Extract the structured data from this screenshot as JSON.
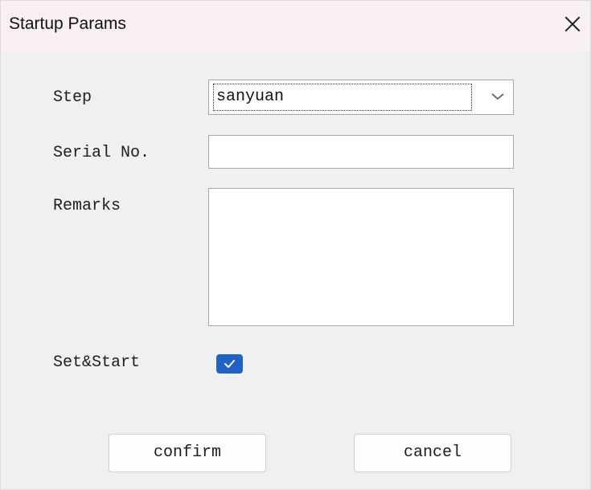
{
  "window": {
    "title": "Startup Params",
    "close_icon": "close-icon"
  },
  "form": {
    "step_label": "Step",
    "step_value": "sanyuan",
    "step_arrow_icon": "chevron-down-icon",
    "serial_label": "Serial No.",
    "serial_value": "",
    "remarks_label": "Remarks",
    "remarks_value": "",
    "set_start_label": "Set&Start",
    "set_start_checked": true
  },
  "buttons": {
    "confirm": "confirm",
    "cancel": "cancel"
  },
  "colors": {
    "titlebar_bg": "#f9f0f6",
    "content_bg": "#f0f0f0",
    "checkbox_bg": "#1f63c7"
  }
}
